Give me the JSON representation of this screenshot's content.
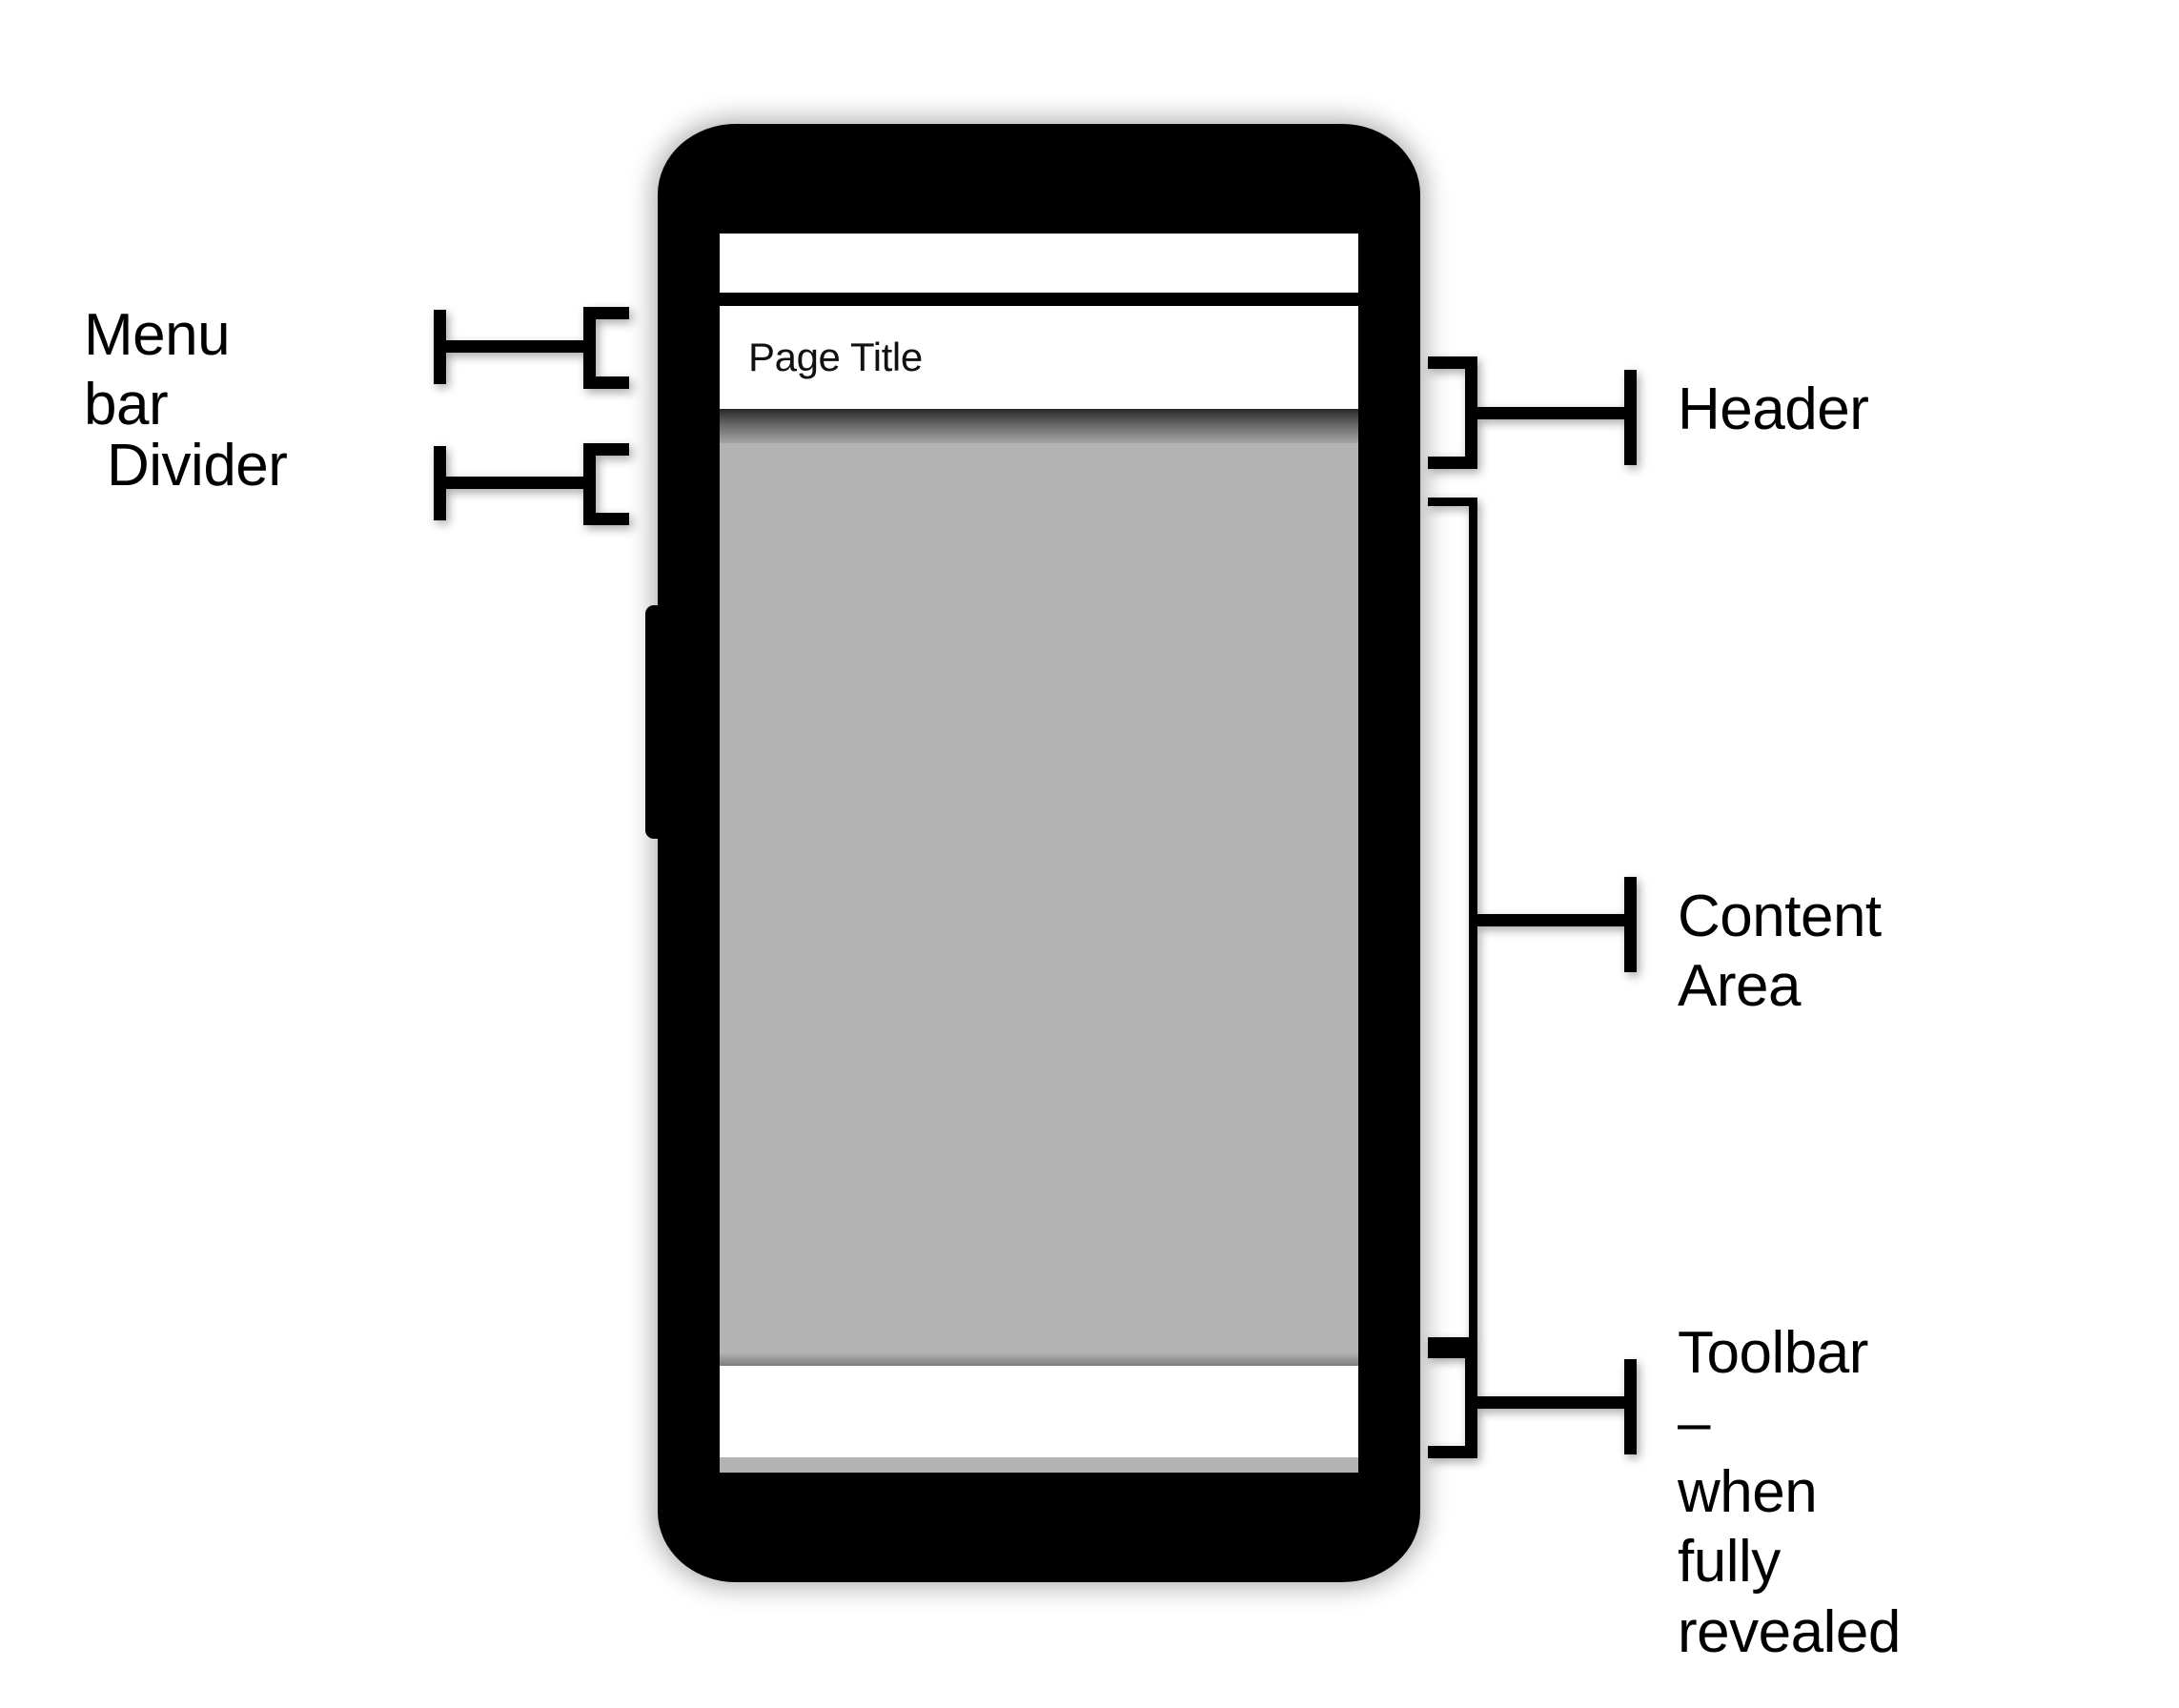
{
  "diagram": {
    "title": "Mobile page anatomy annotation diagram",
    "background_color": "#ffffff",
    "line_color": "#000000"
  },
  "device": {
    "name": "smartphone-mockup",
    "body_color": "#000000",
    "side_button": "volume-button"
  },
  "screen": {
    "menu_bar": {
      "label": "menu-bar",
      "color": "#ffffff"
    },
    "divider": {
      "label": "divider",
      "color": "#000000"
    },
    "header": {
      "page_title": "Page Title",
      "color": "#ffffff"
    },
    "content_area": {
      "label": "content-area",
      "color": "#b4b4b4"
    },
    "toolbar": {
      "label": "toolbar",
      "color": "#ffffff"
    }
  },
  "callouts": {
    "left": [
      {
        "id": "menu-bar",
        "label": "Menu bar"
      },
      {
        "id": "divider",
        "label": "Divider"
      }
    ],
    "right": [
      {
        "id": "header",
        "label": "Header"
      },
      {
        "id": "content-area",
        "label": "Content\nArea"
      },
      {
        "id": "toolbar",
        "label": "Toolbar –\nwhen\nfully\nrevealed"
      }
    ]
  }
}
